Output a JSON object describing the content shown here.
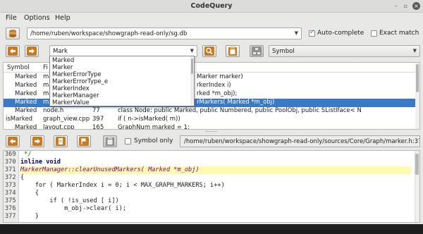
{
  "window": {
    "title": "CodeQuery"
  },
  "menu": [
    "File",
    "Options",
    "Help"
  ],
  "toolbar1": {
    "db_path": "/home/ruben/workspace/showgraph-read-only/sg.db",
    "autocomplete_label": "Auto-complete",
    "autocomplete_checked": true,
    "exact_match_label": "Exact match",
    "exact_match_checked": false
  },
  "toolbar2": {
    "search_value": "Mark",
    "search_type": "Symbol"
  },
  "autocomplete": {
    "items": [
      "Marked",
      "Marker",
      "MarkerErrorType",
      "MarkerErrorType_e",
      "MarkerIndex",
      "MarkerManager",
      "MarkerValue"
    ]
  },
  "results": {
    "headers": [
      "Symbol",
      "Fi"
    ],
    "rows": [
      {
        "symbol": "Marked",
        "file": "ma",
        "line": "",
        "text": "Marker marker)"
      },
      {
        "symbol": "Marked",
        "file": "ma",
        "line": "",
        "text": "rkerIndex i)"
      },
      {
        "symbol": "Marked",
        "file": "ma",
        "line": "",
        "text": "rked *m_obj);"
      },
      {
        "symbol": "Marked",
        "file": "ma",
        "line": "",
        "text": "rMarkers( Marked *m_obj)"
      },
      {
        "symbol": "Marked",
        "file": "node.h",
        "line": "77",
        "text": "class Node: public Marked, public Numbered, public PoolObj, public SListIface< N"
      },
      {
        "symbol": "isMarked",
        "file": "graph_view.cpp",
        "line": "397",
        "text": "if ( n->isMarked( m))"
      },
      {
        "symbol": "Marked",
        "file": "layout.cpp",
        "line": "165",
        "text": "GraphNum marked = 1;"
      }
    ]
  },
  "toolbar3": {
    "symbol_only_label": "Symbol only",
    "symbol_only_checked": false,
    "file_path": "/home/ruben/workspace/showgraph-read-only/sources/Core/Graph/marker.h:371"
  },
  "editor": {
    "line_numbers": [
      "369",
      "370",
      "371",
      "372",
      "373",
      "374",
      "375",
      "376",
      "377"
    ],
    "lines": [
      " */",
      "inline void",
      "MarkerManager::clearUnusedMarkers( Marked *m_obj)",
      "{",
      "    for ( MarkerIndex i = 0; i < MAX_GRAPH_MARKERS; i++)",
      "    {",
      "        if ( !is_used [ i])",
      "            m_obj->clear( i);",
      "    }"
    ]
  }
}
